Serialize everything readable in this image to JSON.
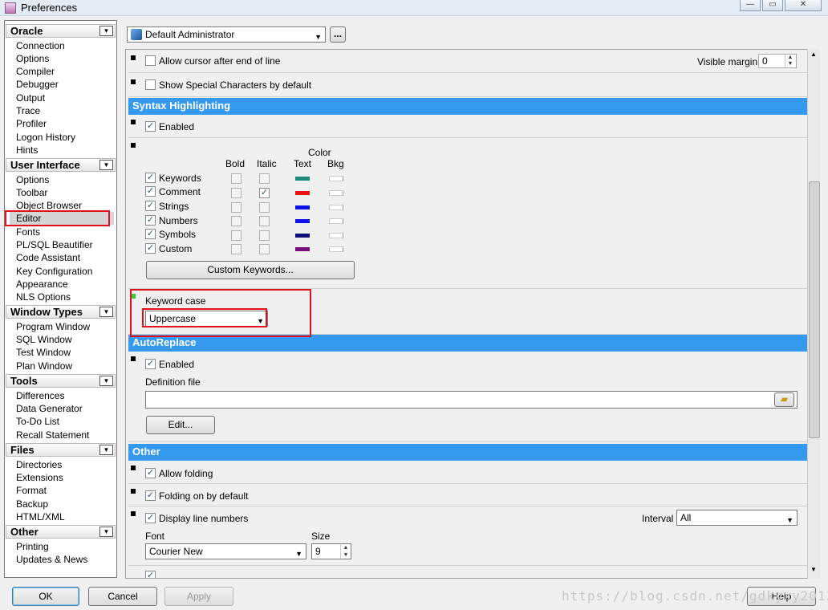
{
  "window": {
    "title": "Preferences",
    "controls": [
      "minimize-icon",
      "maximize-icon",
      "close-icon"
    ]
  },
  "sidebar": {
    "categories": [
      {
        "label": "Oracle",
        "items": [
          "Connection",
          "Options",
          "Compiler",
          "Debugger",
          "Output",
          "Trace",
          "Profiler",
          "Logon History",
          "Hints"
        ]
      },
      {
        "label": "User Interface",
        "items": [
          "Options",
          "Toolbar",
          "Object Browser",
          "Editor",
          "Fonts",
          "PL/SQL Beautifier",
          "Code Assistant",
          "Key Configuration",
          "Appearance",
          "NLS Options"
        ]
      },
      {
        "label": "Window Types",
        "items": [
          "Program Window",
          "SQL Window",
          "Test Window",
          "Plan Window"
        ]
      },
      {
        "label": "Tools",
        "items": [
          "Differences",
          "Data Generator",
          "To-Do List",
          "Recall Statement"
        ]
      },
      {
        "label": "Files",
        "items": [
          "Directories",
          "Extensions",
          "Format",
          "Backup",
          "HTML/XML"
        ]
      },
      {
        "label": "Other",
        "items": [
          "Printing",
          "Updates & News"
        ]
      }
    ],
    "selected": "Editor"
  },
  "profile": {
    "value": "Default Administrator",
    "more_label": "..."
  },
  "editor": {
    "cursor_row": {
      "label": "Allow cursor after end of line",
      "checked": false,
      "visible_margin_label": "Visible margin",
      "visible_margin_value": "0"
    },
    "special_chars": {
      "label": "Show Special Characters by default",
      "checked": false
    },
    "syntax": {
      "header": "Syntax Highlighting",
      "enabled_label": "Enabled",
      "enabled": true,
      "col_bold": "Bold",
      "col_italic": "Italic",
      "col_color": "Color",
      "col_text": "Text",
      "col_bkg": "Bkg",
      "items": [
        {
          "label": "Keywords",
          "bold": false,
          "italic": false,
          "color": "#1a8a7a"
        },
        {
          "label": "Comment",
          "bold": false,
          "italic": true,
          "color": "#e81010"
        },
        {
          "label": "Strings",
          "bold": false,
          "italic": false,
          "color": "#1010e8"
        },
        {
          "label": "Numbers",
          "bold": false,
          "italic": false,
          "color": "#1010e8"
        },
        {
          "label": "Symbols",
          "bold": false,
          "italic": false,
          "color": "#10107a"
        },
        {
          "label": "Custom",
          "bold": false,
          "italic": false,
          "color": "#7a107a"
        }
      ],
      "custom_keywords_button": "Custom Keywords...",
      "keyword_case_label": "Keyword case",
      "keyword_case_value": "Uppercase"
    },
    "autoreplace": {
      "header": "AutoReplace",
      "enabled_label": "Enabled",
      "enabled": true,
      "definition_file_label": "Definition file",
      "definition_file_value": "",
      "edit_button": "Edit..."
    },
    "other": {
      "header": "Other",
      "allow_folding_label": "Allow folding",
      "folding_default_label": "Folding on by default",
      "line_numbers_label": "Display line numbers",
      "interval_label": "Interval",
      "interval_value": "All",
      "font_label": "Font",
      "font_value": "Courier New",
      "size_label": "Size",
      "size_value": "9"
    }
  },
  "footer": {
    "ok": "OK",
    "cancel": "Cancel",
    "apply": "Apply",
    "help": "Help"
  },
  "watermark": "https://blog.csdn.net/gdkyxy2013"
}
